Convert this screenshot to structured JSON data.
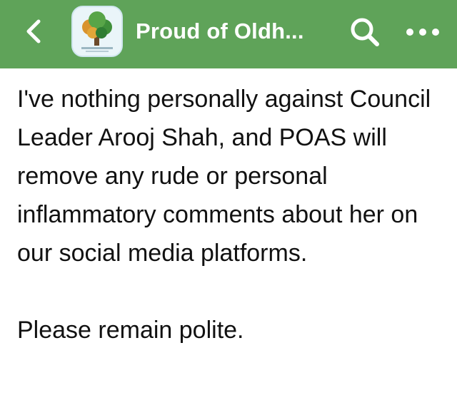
{
  "header": {
    "background_color": "#5fa359",
    "back_icon": "chevron-left-icon",
    "group_avatar": "tree-logo",
    "title": "Proud of Oldh...",
    "search_icon": "search-icon",
    "more_icon": "more-dots-icon"
  },
  "post": {
    "paragraph_1": "I've nothing personally against Council Leader Arooj Shah, and POAS will remove any rude or personal inflammatory comments about her on our social media platforms.",
    "paragraph_2": "Please remain polite."
  }
}
